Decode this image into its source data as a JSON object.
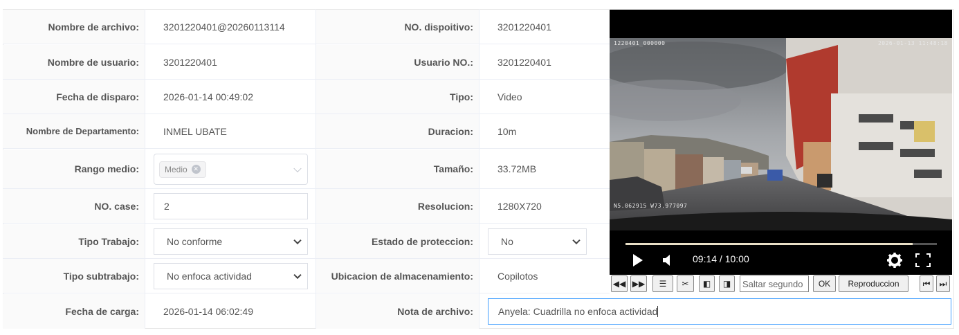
{
  "fields": {
    "nombre_archivo": {
      "label": "Nombre de archivo:",
      "value": "3201220401@20260113114"
    },
    "nombre_usuario": {
      "label": "Nombre de usuario:",
      "value": "3201220401"
    },
    "fecha_disparo": {
      "label": "Fecha de disparo:",
      "value": "2026-01-14 00:49:02"
    },
    "departamento": {
      "label": "Nombre de Departamento:",
      "value": "INMEL UBATE"
    },
    "rango_medio": {
      "label": "Rango medio:",
      "tag": "Medio"
    },
    "no_case": {
      "label": "NO. case:",
      "value": "2"
    },
    "tipo_trabajo": {
      "label": "Tipo Trabajo:",
      "value": "No conforme"
    },
    "tipo_subtrabajo": {
      "label": "Tipo subtrabajo:",
      "value": "No enfoca actividad"
    },
    "fecha_carga": {
      "label": "Fecha de carga:",
      "value": "2026-01-14 06:02:49"
    },
    "no_dispositivo": {
      "label": "NO. dispoitivo:",
      "value": "3201220401"
    },
    "usuario_no": {
      "label": "Usuario NO.:",
      "value": "3201220401"
    },
    "tipo": {
      "label": "Tipo:",
      "value": "Video"
    },
    "duracion": {
      "label": "Duracion:",
      "value": "10m"
    },
    "tamano": {
      "label": "Tamaño:",
      "value": "33.72MB"
    },
    "resolucion": {
      "label": "Resolucion:",
      "value": "1280X720"
    },
    "estado_proteccion": {
      "label": "Estado de proteccion:",
      "value": "No"
    },
    "ubicacion": {
      "label": "Ubicacion de almacenamiento:",
      "value": "Copilotos"
    },
    "nota_archivo": {
      "label": "Nota de archivo:",
      "value": "Anyela: Cuadrilla no enfoca actividad"
    }
  },
  "video": {
    "osd_left": "1220401_000000",
    "osd_right": "2026-01-13 11:48:18",
    "osd_gps": "N5.062915 W73.977097",
    "time": "09:14 / 10:00",
    "progress": 0.923
  },
  "toolbar": {
    "seek_placeholder": "Saltar segundo",
    "ok_label": "OK",
    "playback_label": "Reproduccion"
  }
}
